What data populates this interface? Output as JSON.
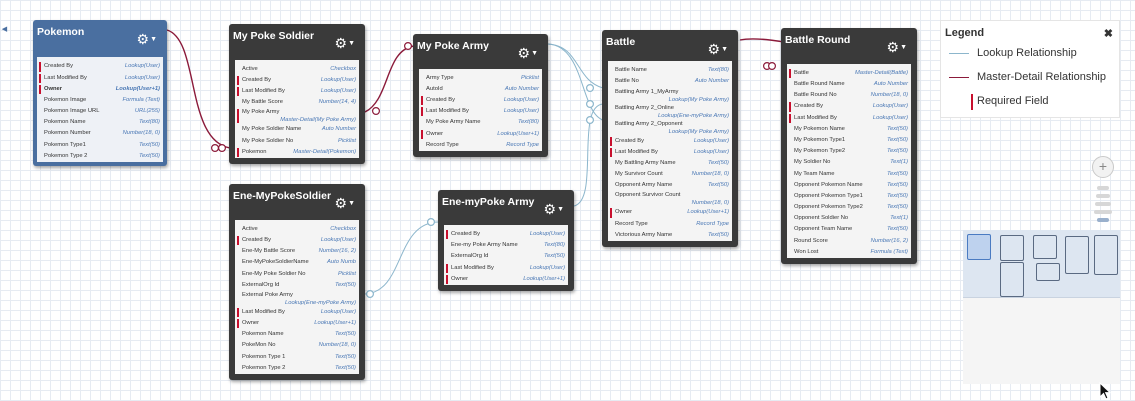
{
  "objects": [
    {
      "id": "pokemon",
      "name": "Pokemon",
      "theme": "blue",
      "fields": [
        {
          "n": "Created By",
          "t": "Lookup(User)",
          "req": true
        },
        {
          "n": "Last Modified By",
          "t": "Lookup(User)",
          "req": true
        },
        {
          "n": "Owner",
          "t": "Lookup(User+1)",
          "req": true,
          "bold": true
        },
        {
          "n": "Pokemon Image",
          "t": "Formula (Text)"
        },
        {
          "n": "Pokemon Image URL",
          "t": "URL(255)"
        },
        {
          "n": "Pokemon Name",
          "t": "Text(80)"
        },
        {
          "n": "Pokemon Number",
          "t": "Number(18, 0)"
        },
        {
          "n": "Pokemon Type1",
          "t": "Text(50)"
        },
        {
          "n": "Pokemon Type 2",
          "t": "Text(50)"
        }
      ]
    },
    {
      "id": "soldier",
      "name": "My Poke Soldier",
      "theme": "dark",
      "fields": [
        {
          "n": "Active",
          "t": "Checkbox"
        },
        {
          "n": "Created By",
          "t": "Lookup(User)",
          "req": true
        },
        {
          "n": "Last Modified By",
          "t": "Lookup(User)",
          "req": true
        },
        {
          "n": "My Battle Score",
          "t": "Number(14, 4)"
        },
        {
          "n": "My Poke Army",
          "t": "Master-Detail(My Poke Army)",
          "req": true,
          "tall": true
        },
        {
          "n": "My Poke Soldier Name",
          "t": "Auto Number"
        },
        {
          "n": "My Poke Soldier No",
          "t": "Picklist"
        },
        {
          "n": "Pokemon",
          "t": "Master-Detail(Pokemon)",
          "req": true
        }
      ]
    },
    {
      "id": "army",
      "name": "My Poke Army",
      "theme": "dark",
      "fields": [
        {
          "n": "Army Type",
          "t": "Picklist"
        },
        {
          "n": "AutoId",
          "t": "Auto Number"
        },
        {
          "n": "Created By",
          "t": "Lookup(User)",
          "req": true
        },
        {
          "n": "Last Modified By",
          "t": "Lookup(User)",
          "req": true
        },
        {
          "n": "My Poke Army Name",
          "t": "Text(80)"
        },
        {
          "n": "Owner",
          "t": "Lookup(User+1)",
          "req": true
        },
        {
          "n": "Record Type",
          "t": "Record Type"
        }
      ]
    },
    {
      "id": "battle",
      "name": "Battle",
      "theme": "dark",
      "fields": [
        {
          "n": "Battle Name",
          "t": "Text(80)"
        },
        {
          "n": "Battle No",
          "t": "Auto Number"
        },
        {
          "n": "Battling Army 1_MyArmy",
          "t": "Lookup(My Poke Army)",
          "tall": true
        },
        {
          "n": "Battling Army 2_Online",
          "t": "Lookup(Ene-myPoke Army)",
          "tall": true
        },
        {
          "n": "Battling Army 2_Opponent",
          "t": "Lookup(My Poke Army)",
          "tall": true
        },
        {
          "n": "Created By",
          "t": "Lookup(User)",
          "req": true
        },
        {
          "n": "Last Modified By",
          "t": "Lookup(User)",
          "req": true
        },
        {
          "n": "My Battling Army Name",
          "t": "Text(50)"
        },
        {
          "n": "My Survivor Count",
          "t": "Number(18, 0)"
        },
        {
          "n": "Opponent Army Name",
          "t": "Text(50)"
        },
        {
          "n": "Opponent Survivor Count",
          "t": "Number(18, 0)",
          "tall": true
        },
        {
          "n": "Owner",
          "t": "Lookup(User+1)",
          "req": true
        },
        {
          "n": "Record Type",
          "t": "Record Type"
        },
        {
          "n": "Victorious Army Name",
          "t": "Text(50)"
        }
      ]
    },
    {
      "id": "round",
      "name": "Battle Round",
      "theme": "dark",
      "fields": [
        {
          "n": "Battle",
          "t": "Master-Detail(Battle)",
          "req": true
        },
        {
          "n": "Battle Round Name",
          "t": "Auto Number"
        },
        {
          "n": "Battle Round No",
          "t": "Number(18, 0)"
        },
        {
          "n": "Created By",
          "t": "Lookup(User)",
          "req": true
        },
        {
          "n": "Last Modified By",
          "t": "Lookup(User)",
          "req": true
        },
        {
          "n": "My Pokemon Name",
          "t": "Text(50)"
        },
        {
          "n": "My Pokemon Type1",
          "t": "Text(50)"
        },
        {
          "n": "My Pokemon Type2",
          "t": "Text(50)"
        },
        {
          "n": "My Soldier No",
          "t": "Text(1)"
        },
        {
          "n": "My Team Name",
          "t": "Text(50)"
        },
        {
          "n": "Opponent Pokemon Name",
          "t": "Text(50)"
        },
        {
          "n": "Opponent Pokemon Type1",
          "t": "Text(50)"
        },
        {
          "n": "Opponent Pokemon Type2",
          "t": "Text(50)"
        },
        {
          "n": "Opponent Soldier No",
          "t": "Text(1)"
        },
        {
          "n": "Opponent Team Name",
          "t": "Text(50)"
        },
        {
          "n": "Round Score",
          "t": "Number(16, 2)"
        },
        {
          "n": "Won Lost",
          "t": "Formula (Text)"
        }
      ]
    },
    {
      "id": "enesoldier",
      "name": "Ene-MyPokeSoldier",
      "theme": "dark",
      "fields": [
        {
          "n": "Active",
          "t": "Checkbox"
        },
        {
          "n": "Created By",
          "t": "Lookup(User)",
          "req": true
        },
        {
          "n": "Ene-My Battle Score",
          "t": "Number(16, 2)"
        },
        {
          "n": "Ene-MyPokeSoldierName",
          "t": "Auto Numb"
        },
        {
          "n": "Ene-My Poke Soldier No",
          "t": "Picklist"
        },
        {
          "n": "ExternalOrg Id",
          "t": "Text(50)"
        },
        {
          "n": "External Poke Army",
          "t": "Lookup(Ene-myPoke Army)",
          "tall": true
        },
        {
          "n": "Last Modified By",
          "t": "Lookup(User)",
          "req": true
        },
        {
          "n": "Owner",
          "t": "Lookup(User+1)",
          "req": true
        },
        {
          "n": "Pokemon Name",
          "t": "Text(50)"
        },
        {
          "n": "PokeMon No",
          "t": "Number(18, 0)"
        },
        {
          "n": "Pokemon Type 1",
          "t": "Text(50)"
        },
        {
          "n": "Pokemon Type 2",
          "t": "Text(50)"
        }
      ]
    },
    {
      "id": "enearmy",
      "name": "Ene-myPoke Army",
      "theme": "dark",
      "fields": [
        {
          "n": "Created By",
          "t": "Lookup(User)",
          "req": true
        },
        {
          "n": "Ene-my Poke Army Name",
          "t": "Text(80)"
        },
        {
          "n": "ExternalOrg Id",
          "t": "Text(50)"
        },
        {
          "n": "Last Modified By",
          "t": "Lookup(User)",
          "req": true
        },
        {
          "n": "Owner",
          "t": "Lookup(User+1)",
          "req": true
        }
      ]
    }
  ],
  "legend": {
    "title": "Legend",
    "close": "✖",
    "lookup_label": "Lookup Relationship",
    "master_label": "Master-Detail Relationship",
    "required_label": "Required Field"
  },
  "colors": {
    "lookup": "#8cb6cc",
    "master": "#8b1a3a",
    "required": "#c8102e",
    "header_dark": "#3a3a3a",
    "header_blue": "#4a6fa0"
  },
  "icons": {
    "gear": "gear-icon",
    "close": "close-icon",
    "zoom_in": "plus-icon",
    "collapse": "chevron-left-icon"
  },
  "zoom": {
    "plus": "+"
  }
}
